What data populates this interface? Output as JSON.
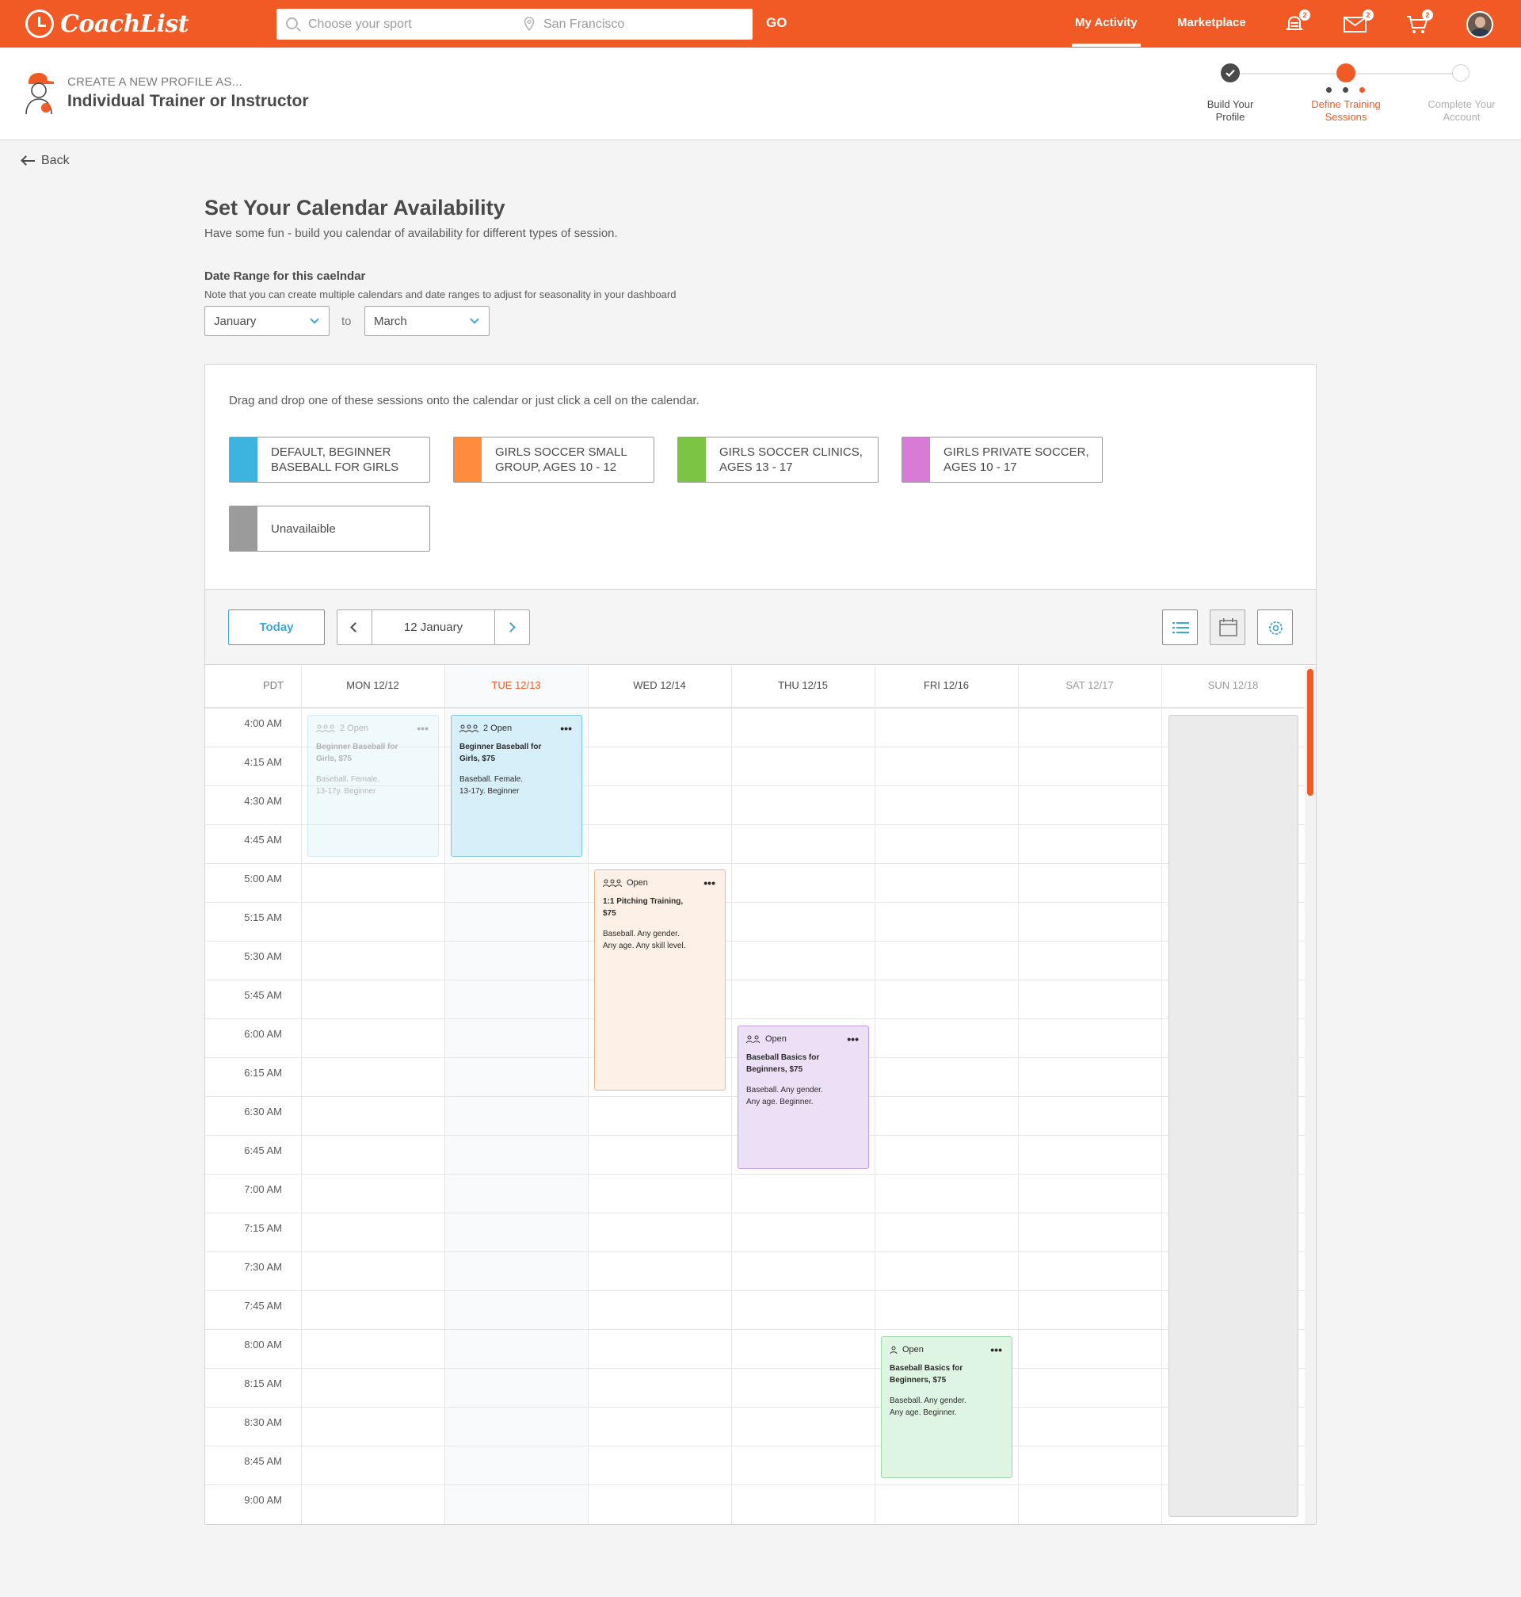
{
  "app": {
    "brand": "CoachList",
    "accent": "#f15a24",
    "link": "#3ca8d8"
  },
  "search": {
    "sport_placeholder": "Choose your sport",
    "location_value": "San Francisco",
    "go_label": "GO"
  },
  "nav": {
    "my_activity": "My Activity",
    "marketplace": "Marketplace",
    "notifications_count": "2",
    "messages_count": "2",
    "cart_count": "2"
  },
  "profile": {
    "create_as": "CREATE A NEW PROFILE AS...",
    "type": "Individual Trainer or Instructor"
  },
  "steps": [
    {
      "label_1": "Build Your",
      "label_2": "Profile",
      "state": "done"
    },
    {
      "label_1": "Define Training",
      "label_2": "Sessions",
      "state": "current"
    },
    {
      "label_1": "Complete Your",
      "label_2": "Account",
      "state": "todo"
    }
  ],
  "back_label": "Back",
  "page": {
    "title": "Set Your Calendar Availability",
    "subtitle": "Have some fun - build you calendar of availability for different types of session.",
    "date_range_label": "Date Range for this caelndar",
    "date_range_note": "Note that you can create multiple calendars and date ranges to adjust for seasonality in your dashboard",
    "from_month": "January",
    "to_label": "to",
    "to_month": "March"
  },
  "sessions": {
    "drag_note": "Drag and drop one of these sessions onto the calendar or just click a cell on the calendar.",
    "types": [
      {
        "line1": "DEFAULT, BEGINNER",
        "line2": "BASEBALL FOR GIRLS",
        "color": "#3db4e0"
      },
      {
        "line1": "GIRLS SOCCER SMALL",
        "line2": "GROUP, AGES 10 - 12",
        "color": "#ff8c3c"
      },
      {
        "line1": "GIRLS SOCCER CLINICS,",
        "line2": "AGES 13 - 17",
        "color": "#7cc544"
      },
      {
        "line1": "GIRLS PRIVATE SOCCER,",
        "line2": "AGES 10 - 17",
        "color": "#d67bd6"
      },
      {
        "line1": "Unavailaible",
        "line2": "",
        "color": "#9b9b9b"
      }
    ]
  },
  "calendar": {
    "today_label": "Today",
    "current_date": "12 January",
    "timezone": "PDT",
    "days": [
      "MON 12/12",
      "TUE 12/13",
      "WED 12/14",
      "THU 12/15",
      "FRI 12/16",
      "SAT 12/17",
      "SUN 12/18"
    ],
    "today_index": 1,
    "times": [
      "4:00 AM",
      "4:15 AM",
      "4:30 AM",
      "4:45 AM",
      "5:00 AM",
      "5:15 AM",
      "5:30 AM",
      "5:45 AM",
      "6:00 AM",
      "6:15 AM",
      "6:30 AM",
      "6:45 AM",
      "7:00 AM",
      "7:15 AM",
      "7:30 AM",
      "7:45 AM",
      "8:00 AM",
      "8:15 AM",
      "8:30 AM",
      "8:45 AM",
      "9:00 AM"
    ],
    "events": [
      {
        "count": "2 Open",
        "name_1": "Beginner Baseball for",
        "name_2": "Girls, $75",
        "desc_1": "Baseball. Female.",
        "desc_2": "13-17y. Beginner",
        "bg": "#d6eff8",
        "border": "#7fc9e6",
        "faded": true
      },
      {
        "count": "2 Open",
        "name_1": "Beginner Baseball for",
        "name_2": "Girls, $75",
        "desc_1": "Baseball. Female.",
        "desc_2": "13-17y. Beginner",
        "bg": "#d6eff8",
        "border": "#7fc9e6",
        "faded": false
      },
      {
        "count": "Open",
        "name_1": "1:1 Pitching Training,",
        "name_2": "$75",
        "desc_1": "Baseball. Any gender.",
        "desc_2": "Any age. Any skill level.",
        "bg": "#fdf0e6",
        "border": "#f2b48a",
        "faded": false
      },
      {
        "count": "Open",
        "name_1": "Baseball Basics for",
        "name_2": "Beginners, $75",
        "desc_1": "Baseball. Any gender.",
        "desc_2": "Any age. Beginner.",
        "bg": "#ece0f7",
        "border": "#c79be6",
        "faded": false
      },
      {
        "count": "Open",
        "name_1": "Baseball Basics for",
        "name_2": "Beginners, $75",
        "desc_1": "Baseball. Any gender.",
        "desc_2": "Any age. Beginner.",
        "bg": "#dff5e3",
        "border": "#9fd8a8",
        "faded": false
      }
    ]
  }
}
